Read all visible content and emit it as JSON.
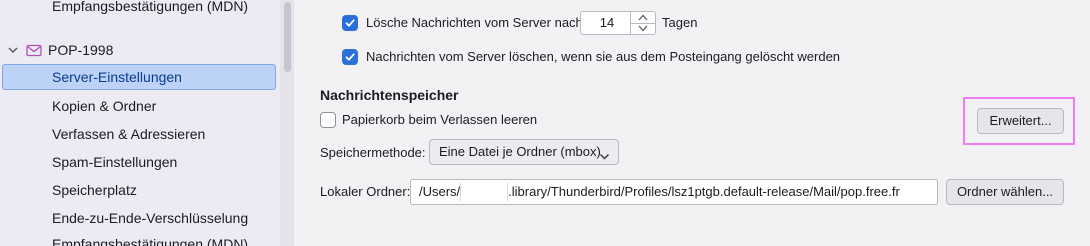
{
  "sidebar": {
    "top_partial_item": "Empfangsbestätigungen (MDN)",
    "account": {
      "name": "POP-1998",
      "icon": "mail-account-icon",
      "chevron": "chevron-down-icon"
    },
    "selected_item": "Server-Einstellungen",
    "items": [
      "Kopien & Ordner",
      "Verfassen & Adressieren",
      "Spam-Einstellungen",
      "Speicherplatz",
      "Ende-zu-Ende-Verschlüsselung"
    ],
    "bottom_partial_item": "Empfangsbestätigungen (MDN)"
  },
  "main": {
    "delete_after": {
      "checked": true,
      "label_before": "Lösche Nachrichten vom Server nach",
      "days": "14",
      "label_after": "Tagen"
    },
    "delete_from_server": {
      "checked": true,
      "label": "Nachrichten vom Server löschen, wenn sie aus dem Posteingang gelöscht werden"
    },
    "storage_heading": "Nachrichtenspeicher",
    "empty_trash": {
      "checked": false,
      "label": "Papierkorb beim Verlassen leeren"
    },
    "advanced_button": "Erweitert...",
    "storage_method": {
      "label": "Speichermethode:",
      "selected": "Eine Datei je Ordner (mbox)"
    },
    "local_folder": {
      "label": "Lokaler Ordner:",
      "path_prefix": "/Users/",
      "path_suffix": ".library/Thunderbird/Profiles/lsz1ptgb.default-release/Mail/pop.free.fr",
      "choose_button": "Ordner wählen..."
    }
  },
  "colors": {
    "accent": "#2b6fdb",
    "selection": "#bcd3f7",
    "highlight": "#f07cf0"
  }
}
